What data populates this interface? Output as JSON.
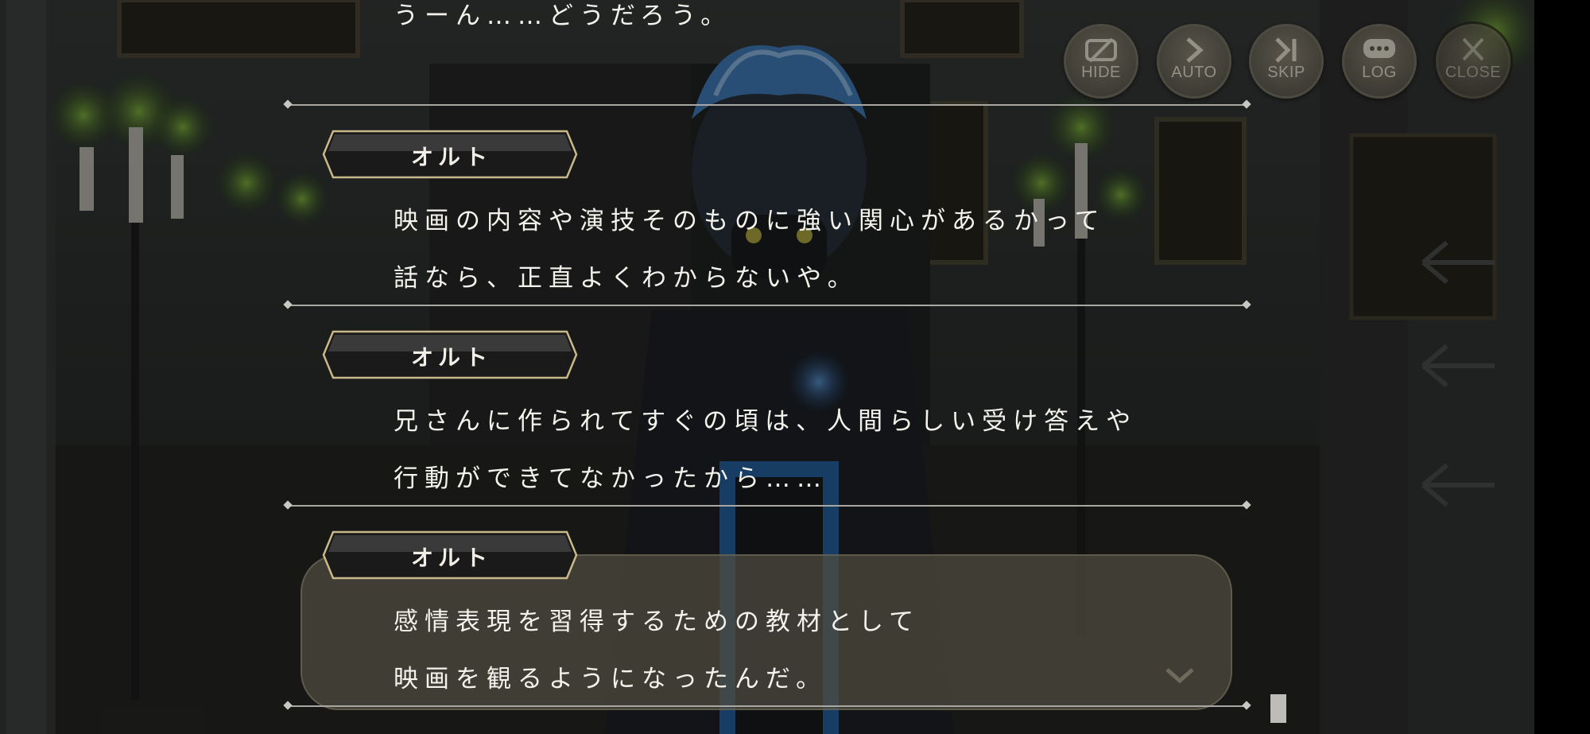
{
  "controls": {
    "hide_label": "HIDE",
    "auto_label": "AUTO",
    "skip_label": "SKIP",
    "log_label": "LOG",
    "close_label": "CLOSE"
  },
  "log": {
    "previous_line": "うーん……どうだろう。",
    "entries": [
      {
        "speaker": "オルト",
        "line1": "映画の内容や演技そのものに強い関心があるかって",
        "line2": "話なら、正直よくわからないや。"
      },
      {
        "speaker": "オルト",
        "line1": "兄さんに作られてすぐの頃は、人間らしい受け答えや",
        "line2": "行動ができてなかったから……"
      },
      {
        "speaker": "オルト",
        "line1": "感情表現を習得するための教材として",
        "line2": "映画を観るようになったんだ。"
      }
    ]
  },
  "colors": {
    "text": "#f4f2ec",
    "nameplate_border": "#c9b98a",
    "divider": "#a9a7a2",
    "accent_flame": "#3f7bd6"
  }
}
